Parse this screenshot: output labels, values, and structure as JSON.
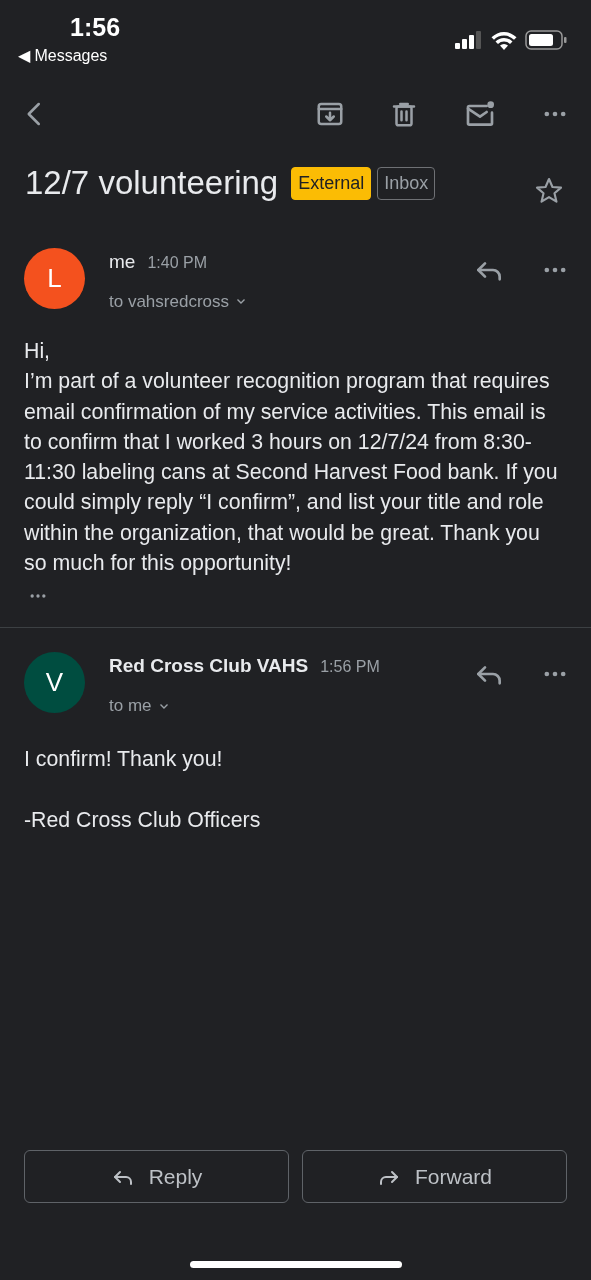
{
  "status_bar": {
    "time": "1:56",
    "back_label": "◀ Messages"
  },
  "subject": "12/7 volunteering",
  "labels": [
    {
      "text": "External",
      "kind": "filled"
    },
    {
      "text": "Inbox",
      "kind": "outlined"
    }
  ],
  "starred": false,
  "messages": [
    {
      "initial": "L",
      "color": "#f4511e",
      "sender": "me",
      "unread": false,
      "time": "1:40 PM",
      "recipient": "to vahsredcross",
      "paragraphs": [
        "Hi,\nI’m part of a volunteer recognition program that requires email confirmation of my service activities. This email is to confirm that I worked 3 hours on 12/7/24 from 8:30-11:30 labeling cans at Second Harvest Food bank. If you could simply reply “I confirm”, and list your title and role within the organization, that would be great. Thank you so much for this opportunity!"
      ],
      "trimmed": true
    },
    {
      "initial": "V",
      "color": "#004d40",
      "sender": "Red Cross Club VAHS",
      "unread": true,
      "time": "1:56 PM",
      "recipient": "to me",
      "paragraphs": [
        "I confirm! Thank you!",
        "-Red Cross Club Officers"
      ],
      "trimmed": false
    }
  ],
  "actions": [
    {
      "label": "Reply",
      "kind": "reply"
    },
    {
      "label": "Forward",
      "kind": "forward"
    }
  ]
}
